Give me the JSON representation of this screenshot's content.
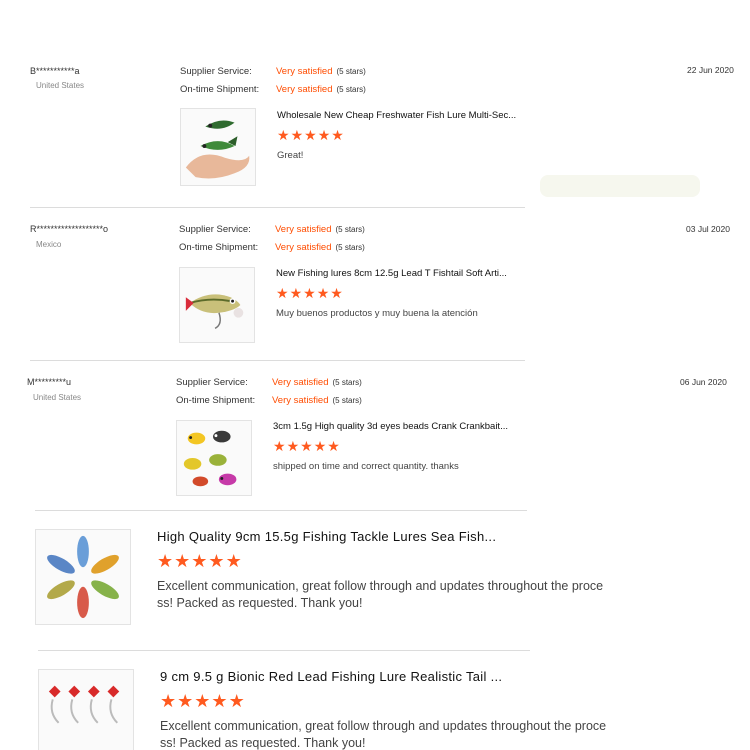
{
  "reviews_small": [
    {
      "buyer": "B***********a",
      "country": "United States",
      "supplier_label": "Supplier Service:",
      "supplier_value": "Very satisfied",
      "supplier_stars": "(5 stars)",
      "shipment_label": "On-time Shipment:",
      "shipment_value": "Very satisfied",
      "shipment_stars": "(5 stars)",
      "date": "22 Jun 2020",
      "product": "Wholesale New Cheap Freshwater Fish Lure Multi-Sec...",
      "rating": 5,
      "comment": "Great!"
    },
    {
      "buyer": "R*******************o",
      "country": "Mexico",
      "supplier_label": "Supplier Service:",
      "supplier_value": "Very satisfied",
      "supplier_stars": "(5 stars)",
      "shipment_label": "On-time Shipment:",
      "shipment_value": "Very satisfied",
      "shipment_stars": "(5 stars)",
      "date": "03 Jul 2020",
      "product": "New Fishing lures 8cm 12.5g Lead T Fishtail Soft Arti...",
      "rating": 5,
      "comment": "Muy buenos productos y muy buena la atención"
    },
    {
      "buyer": "M*********u",
      "country": "United States",
      "supplier_label": "Supplier Service:",
      "supplier_value": "Very satisfied",
      "supplier_stars": "(5 stars)",
      "shipment_label": "On-time Shipment:",
      "shipment_value": "Very satisfied",
      "shipment_stars": "(5 stars)",
      "date": "06 Jun 2020",
      "product": "3cm 1.5g High quality 3d eyes beads Crank Crankbait...",
      "rating": 5,
      "comment": "shipped on time and correct quantity. thanks"
    }
  ],
  "reviews_big": [
    {
      "product": "High Quality 9cm 15.5g Fishing Tackle Lures Sea Fish...",
      "rating": 5,
      "comment_line1": "Excellent communication, great follow through and updates throughout the proce",
      "comment_line2": "ss! Packed as requested. Thank you!"
    },
    {
      "product": "9 cm 9.5 g Bionic Red Lead Fishing Lure Realistic Tail ...",
      "rating": 5,
      "comment_line1": "Excellent communication, great follow through and updates throughout the proce",
      "comment_line2": "ss! Packed as requested. Thank you!"
    }
  ],
  "colors": {
    "accent": "#ff4c00",
    "star": "#ff5a1f",
    "divider": "#dcdcdc"
  },
  "icons": {
    "star": "star-icon"
  }
}
